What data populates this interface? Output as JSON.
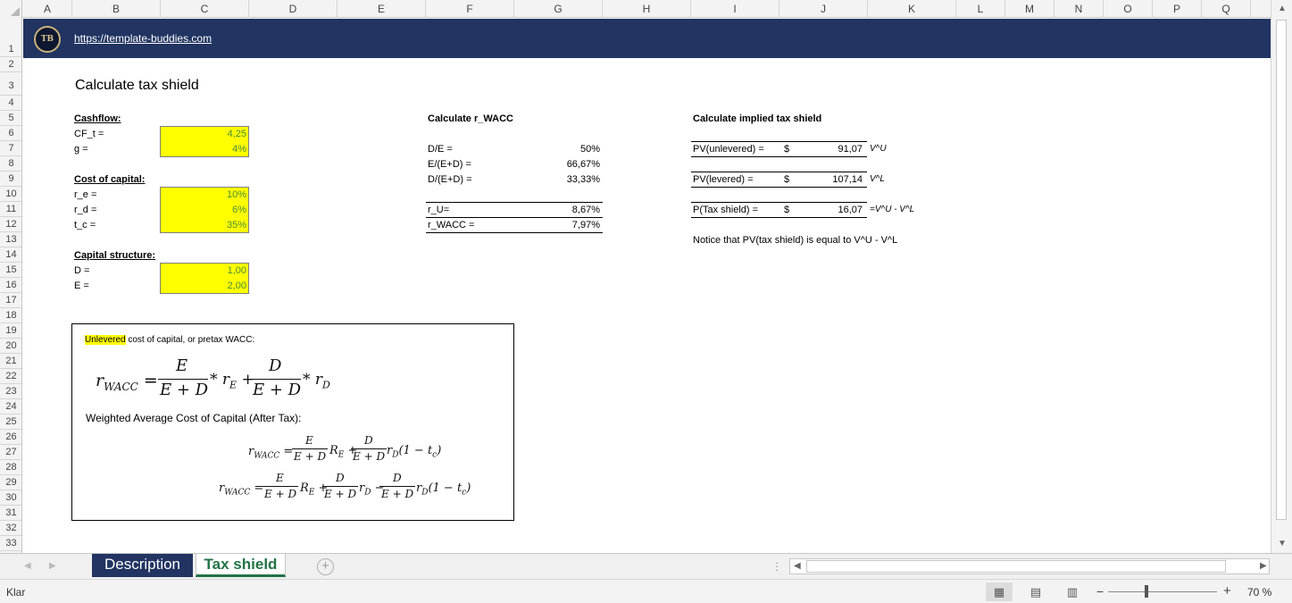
{
  "columns": [
    "A",
    "B",
    "C",
    "D",
    "E",
    "F",
    "G",
    "H",
    "I",
    "J",
    "K",
    "L",
    "M",
    "N",
    "O",
    "P",
    "Q"
  ],
  "rows": [
    "1",
    "2",
    "3",
    "4",
    "5",
    "6",
    "7",
    "8",
    "9",
    "10",
    "11",
    "12",
    "13",
    "14",
    "15",
    "16",
    "17",
    "18",
    "19",
    "20",
    "21",
    "22",
    "23",
    "24",
    "25",
    "26",
    "27",
    "28",
    "29",
    "30",
    "31",
    "32",
    "33"
  ],
  "banner": {
    "url": "https://template-buddies.com",
    "logo_text": "TB"
  },
  "title": "Calculate tax shield",
  "inputs": {
    "cashflow_label": "Cashflow:",
    "cf_label": "CF_t =",
    "cf_value": "4,25",
    "g_label": "g =",
    "g_value": "4%",
    "coc_label": "Cost of capital:",
    "re_label": "r_e =",
    "re_value": "10%",
    "rd_label": "r_d =",
    "rd_value": "6%",
    "tc_label": "t_c =",
    "tc_value": "35%",
    "cs_label": "Capital structure:",
    "d_label": "D =",
    "d_value": "1,00",
    "e_label": "E =",
    "e_value": "2,00"
  },
  "wacc": {
    "heading": "Calculate r_WACC",
    "de_label": "D/E =",
    "de_value": "50%",
    "eed_label": "E/(E+D) =",
    "eed_value": "66,67%",
    "ded_label": "D/(E+D) =",
    "ded_value": "33,33%",
    "ru_label": "r_U=",
    "ru_value": "8,67%",
    "rwacc_label": "r_WACC =",
    "rwacc_value": "7,97%"
  },
  "shield": {
    "heading": "Calculate implied tax shield",
    "pvu_label": "PV(unlevered) =",
    "pvu_cur": "$",
    "pvu_value": "91,07",
    "pvu_note": "V^U",
    "pvl_label": "PV(levered) =",
    "pvl_cur": "$",
    "pvl_value": "107,14",
    "pvl_note": "V^L",
    "pts_label": "P(Tax shield) =",
    "pts_cur": "$",
    "pts_value": "16,07",
    "pts_note": "=V^U - V^L",
    "notice": "Notice that PV(tax shield) is equal to V^U - V^L"
  },
  "equations": {
    "intro_hl": "Unlevered",
    "intro_rest": " cost of capital, or pretax WACC:",
    "after_tax_label": "Weighted Average Cost of Capital (After Tax):"
  },
  "tabs": [
    {
      "label": "Description",
      "active": false
    },
    {
      "label": "Tax shield",
      "active": true
    }
  ],
  "status": {
    "ready": "Klar",
    "zoom": "70 %"
  }
}
